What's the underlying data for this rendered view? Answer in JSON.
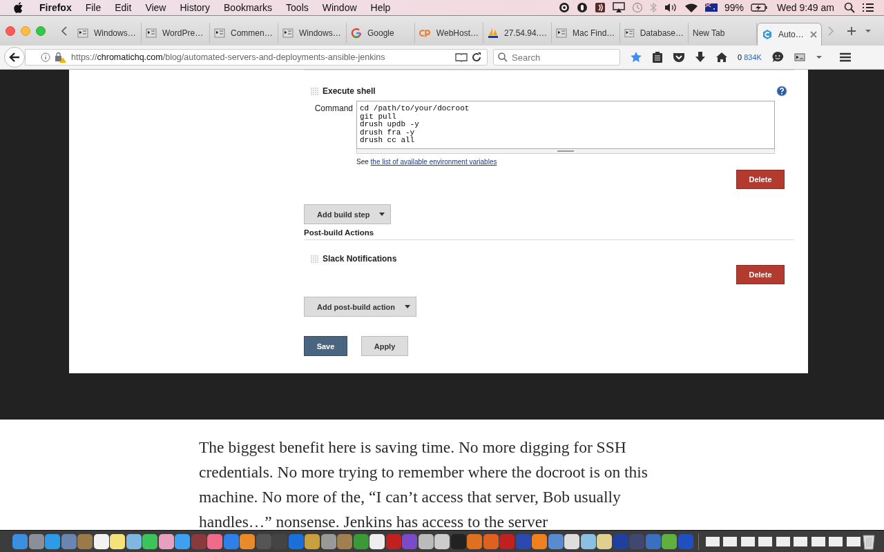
{
  "menu_bar": {
    "app": "Firefox",
    "menus": [
      "File",
      "Edit",
      "View",
      "History",
      "Bookmarks",
      "Tools",
      "Window",
      "Help"
    ],
    "battery": "99%",
    "clock": "Wed 9:49 am"
  },
  "tabs": [
    {
      "label": "Windows…",
      "kind": "page",
      "selected": false
    },
    {
      "label": "WordPre…",
      "kind": "page",
      "selected": false
    },
    {
      "label": "Commen…",
      "kind": "page",
      "selected": false
    },
    {
      "label": "Windows…",
      "kind": "page",
      "selected": false
    },
    {
      "label": "Google",
      "kind": "search",
      "selected": false
    },
    {
      "label": "WebHost…",
      "kind": "hosting",
      "selected": false
    },
    {
      "label": "27.54.94.…",
      "kind": "database",
      "selected": false
    },
    {
      "label": "Mac Find…",
      "kind": "page",
      "selected": false
    },
    {
      "label": "Database…",
      "kind": "page",
      "selected": false
    },
    {
      "label": "New Tab",
      "kind": "blank",
      "selected": false
    },
    {
      "label": "Auto…",
      "kind": "article",
      "selected": true
    }
  ],
  "toolbar": {
    "url_scheme": "https://",
    "url_host": "chromatichq.com",
    "url_path": "/blog/automated-servers-and-deployments-ansible-jenkins",
    "search_placeholder": "Search",
    "counter": "0",
    "counter_size": "834K"
  },
  "jenkins": {
    "build_step": {
      "title": "Execute shell",
      "command_label": "Command",
      "command": "cd /path/to/your/docroot\ngit pull\ndrush updb -y\ndrush fra -y\ndrush cc all",
      "help_prefix": "See",
      "help_link": "the list of available environment variables",
      "delete": "Delete"
    },
    "add_build_step": "Add build step",
    "post_build_heading": "Post-build Actions",
    "post_build_step": {
      "title": "Slack Notifications",
      "delete": "Delete"
    },
    "add_post_build": "Add post-build action",
    "save": "Save",
    "apply": "Apply"
  },
  "article": {
    "paragraph": "The biggest benefit here is saving time. No more digging for SSH credentials. No more trying to remember where the docroot is on this machine. No more of the, “I can’t access that server, Bob usually handles…” nonsense. Jenkins has access to the server"
  }
}
